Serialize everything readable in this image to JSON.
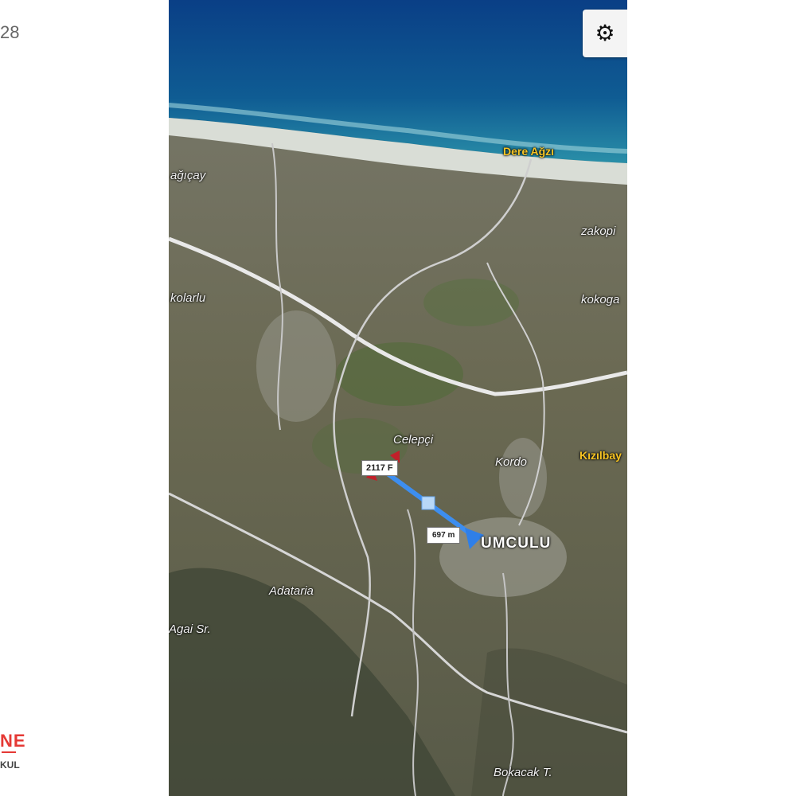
{
  "status_bar": {
    "time_fragment": "28"
  },
  "logo": {
    "mark": "NE",
    "subtitle": "KUL",
    "accent_color": "#e53935"
  },
  "map": {
    "labels": {
      "dere_agzi": "Dere Ağzı",
      "kizilbay": "Kızılbay",
      "celepci": "Celepçi",
      "kordo": "Kordo",
      "town": "UMCULU",
      "adataria": "Adataria",
      "agai_sr": "Agai Sr.",
      "bokacak": "Bokacak T.",
      "zakopi": "zakopi",
      "kokoga": "kokoga",
      "west_1": "ağıçay",
      "west_2": "kolarlu"
    },
    "parcel_marker_label": "2117 F",
    "distance_label": "697 m",
    "settings_icon": "gear-icon",
    "colors": {
      "sea": "#0b4f8a",
      "shore": "#dfe4e2",
      "land": "#6b6a58",
      "road": "#e8e8e8",
      "measure_line": "#3d8ef0",
      "parcel_marker": "#c0202a"
    }
  }
}
